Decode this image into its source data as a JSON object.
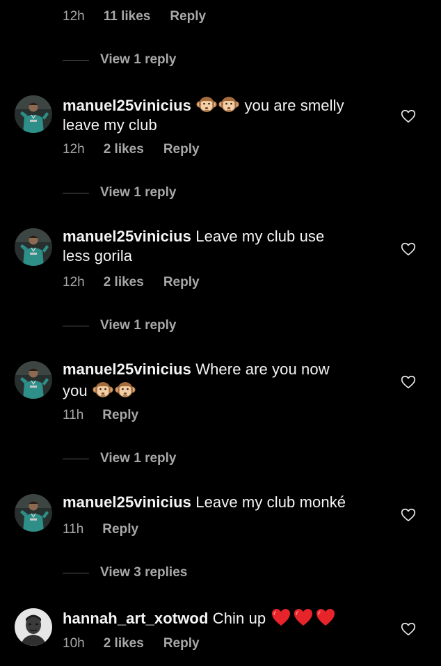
{
  "top_meta": {
    "time": "12h",
    "likes": "11 likes",
    "reply": "Reply"
  },
  "top_view_replies": "View 1 reply",
  "comments": [
    {
      "username": "manuel25vinicius",
      "text_after_emojis": "you are smelly leave my club",
      "time": "12h",
      "likes": "2 likes",
      "reply": "Reply",
      "view_replies": "View 1 reply"
    },
    {
      "username": "manuel25vinicius",
      "text": "Leave my club use less gorila",
      "time": "12h",
      "likes": "2 likes",
      "reply": "Reply",
      "view_replies": "View 1 reply"
    },
    {
      "username": "manuel25vinicius",
      "text": "Where are you now you",
      "time": "11h",
      "reply": "Reply",
      "view_replies": "View 1 reply"
    },
    {
      "username": "manuel25vinicius",
      "text": "Leave my club monké",
      "time": "11h",
      "reply": "Reply",
      "view_replies": "View 3 replies"
    },
    {
      "username": "hannah_art_xotwod",
      "text": "Chin up",
      "time": "10h",
      "likes": "2 likes",
      "reply": "Reply"
    }
  ],
  "icons": {
    "heart": "heart-outline-icon",
    "monkey": "see-no-evil-monkey-emoji",
    "red_heart": "red-heart-emoji"
  },
  "colors": {
    "background": "#000000",
    "text_primary": "#f5f5f5",
    "text_secondary": "#a8a8a8",
    "heart_emoji": "#e8242b"
  }
}
